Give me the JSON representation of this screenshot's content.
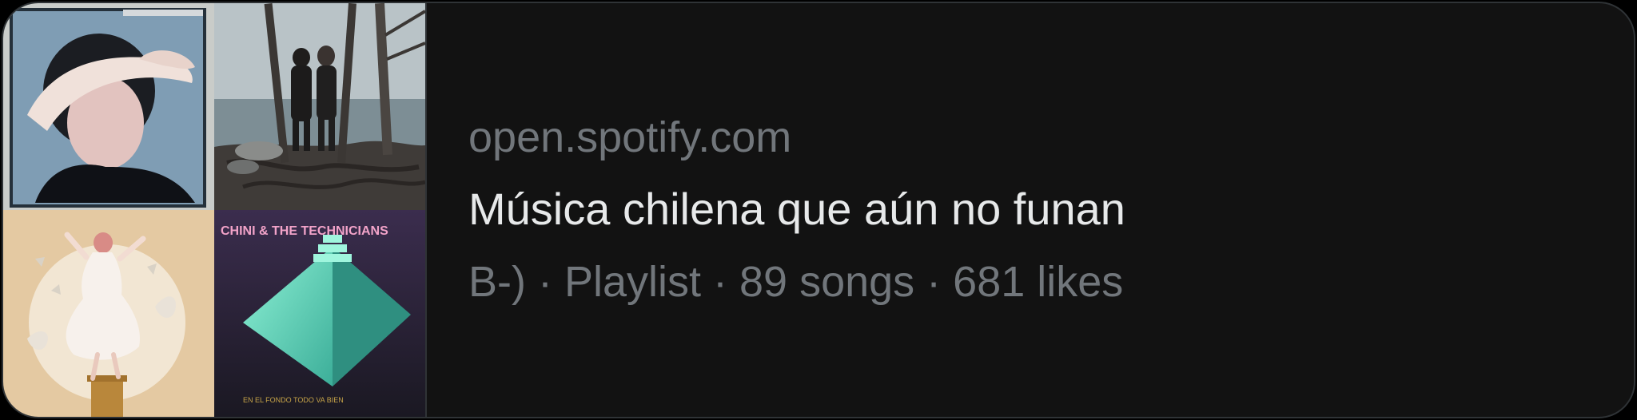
{
  "card": {
    "domain": "open.spotify.com",
    "title": "Música chilena que aún no funan",
    "description": "B-) · Playlist · 89 songs · 681 likes"
  },
  "mosaic": {
    "album_cover_text_1": "CHINI & THE TECHNICIANS",
    "album_cover_text_2": "EN EL FONDO TODO VA BIEN"
  },
  "colors": {
    "background": "#000000",
    "card_background": "#121212",
    "border": "#2f3336",
    "title": "#e7e9ea",
    "secondary_text": "#71767b"
  }
}
